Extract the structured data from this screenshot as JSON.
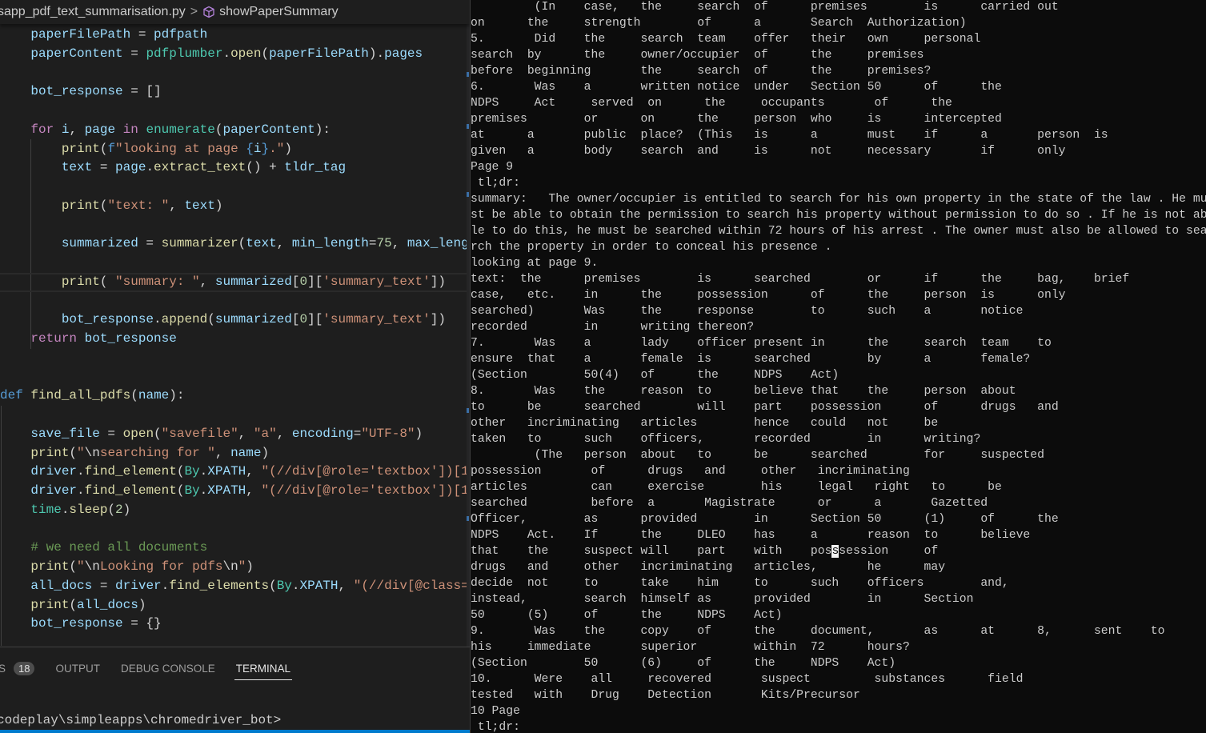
{
  "breadcrumb": {
    "file": "sapp_pdf_text_summarisation.py",
    "separator": ">",
    "symbol": "showPaperSummary",
    "symbol_icon": "cube-icon",
    "symbol_icon_color": "#b180d7"
  },
  "code_lines": [
    [
      [
        "t-p",
        "    "
      ],
      [
        "t-v",
        "paperFilePath"
      ],
      [
        "t-p",
        " = "
      ],
      [
        "t-v",
        "pdfpath"
      ]
    ],
    [
      [
        "t-p",
        "    "
      ],
      [
        "t-v",
        "paperContent"
      ],
      [
        "t-p",
        " = "
      ],
      [
        "t-c",
        "pdfplumber"
      ],
      [
        "t-p",
        "."
      ],
      [
        "t-f",
        "open"
      ],
      [
        "t-p",
        "("
      ],
      [
        "t-v",
        "paperFilePath"
      ],
      [
        "t-p",
        ")."
      ],
      [
        "t-v",
        "pages"
      ]
    ],
    [],
    [
      [
        "t-p",
        "    "
      ],
      [
        "t-v",
        "bot_response"
      ],
      [
        "t-p",
        " = []"
      ]
    ],
    [],
    [
      [
        "t-p",
        "    "
      ],
      [
        "t-k",
        "for"
      ],
      [
        "t-p",
        " "
      ],
      [
        "t-v",
        "i"
      ],
      [
        "t-p",
        ", "
      ],
      [
        "t-v",
        "page"
      ],
      [
        "t-p",
        " "
      ],
      [
        "t-k",
        "in"
      ],
      [
        "t-p",
        " "
      ],
      [
        "t-c",
        "enumerate"
      ],
      [
        "t-p",
        "("
      ],
      [
        "t-v",
        "paperContent"
      ],
      [
        "t-p",
        "):"
      ]
    ],
    [
      [
        "t-p",
        "        "
      ],
      [
        "t-f",
        "print"
      ],
      [
        "t-p",
        "("
      ],
      [
        "t-kw",
        "f"
      ],
      [
        "t-s",
        "\"looking at page "
      ],
      [
        "t-kw",
        "{"
      ],
      [
        "t-v",
        "i"
      ],
      [
        "t-kw",
        "}"
      ],
      [
        "t-s",
        ".\""
      ],
      [
        "t-p",
        ")"
      ]
    ],
    [
      [
        "t-p",
        "        "
      ],
      [
        "t-v",
        "text"
      ],
      [
        "t-p",
        " = "
      ],
      [
        "t-v",
        "page"
      ],
      [
        "t-p",
        "."
      ],
      [
        "t-f",
        "extract_text"
      ],
      [
        "t-p",
        "() + "
      ],
      [
        "t-v",
        "tldr_tag"
      ]
    ],
    [],
    [
      [
        "t-p",
        "        "
      ],
      [
        "t-f",
        "print"
      ],
      [
        "t-p",
        "("
      ],
      [
        "t-s",
        "\"text: \""
      ],
      [
        "t-p",
        ", "
      ],
      [
        "t-v",
        "text"
      ],
      [
        "t-p",
        ")"
      ]
    ],
    [],
    [
      [
        "t-p",
        "        "
      ],
      [
        "t-v",
        "summarized"
      ],
      [
        "t-p",
        " = "
      ],
      [
        "t-f",
        "summarizer"
      ],
      [
        "t-p",
        "("
      ],
      [
        "t-v",
        "text"
      ],
      [
        "t-p",
        ", "
      ],
      [
        "t-v",
        "min_length"
      ],
      [
        "t-p",
        "="
      ],
      [
        "t-n",
        "75"
      ],
      [
        "t-p",
        ", "
      ],
      [
        "t-v",
        "max_leng"
      ]
    ],
    [],
    [
      [
        "t-p",
        "        "
      ],
      [
        "t-f",
        "print"
      ],
      [
        "t-p",
        "( "
      ],
      [
        "t-s",
        "\"summary: \""
      ],
      [
        "t-p",
        ", "
      ],
      [
        "t-v",
        "summarized"
      ],
      [
        "t-p",
        "["
      ],
      [
        "t-n",
        "0"
      ],
      [
        "t-p",
        "]["
      ],
      [
        "t-s",
        "'summary_text'"
      ],
      [
        "t-p",
        "])"
      ]
    ],
    [],
    [
      [
        "t-p",
        "        "
      ],
      [
        "t-v",
        "bot_response"
      ],
      [
        "t-p",
        "."
      ],
      [
        "t-f",
        "append"
      ],
      [
        "t-p",
        "("
      ],
      [
        "t-v",
        "summarized"
      ],
      [
        "t-p",
        "["
      ],
      [
        "t-n",
        "0"
      ],
      [
        "t-p",
        "]["
      ],
      [
        "t-s",
        "'summary_text'"
      ],
      [
        "t-p",
        "])"
      ]
    ],
    [
      [
        "t-p",
        "    "
      ],
      [
        "t-k",
        "return"
      ],
      [
        "t-p",
        " "
      ],
      [
        "t-v",
        "bot_response"
      ]
    ],
    [],
    [],
    [
      [
        "t-kw",
        "def"
      ],
      [
        "t-p",
        " "
      ],
      [
        "t-f",
        "find_all_pdfs"
      ],
      [
        "t-p",
        "("
      ],
      [
        "t-v",
        "name"
      ],
      [
        "t-p",
        "):"
      ]
    ],
    [],
    [
      [
        "t-p",
        "    "
      ],
      [
        "t-v",
        "save_file"
      ],
      [
        "t-p",
        " = "
      ],
      [
        "t-f",
        "open"
      ],
      [
        "t-p",
        "("
      ],
      [
        "t-s",
        "\"savefile\""
      ],
      [
        "t-p",
        ", "
      ],
      [
        "t-s",
        "\"a\""
      ],
      [
        "t-p",
        ", "
      ],
      [
        "t-v",
        "encoding"
      ],
      [
        "t-p",
        "="
      ],
      [
        "t-s",
        "\"UTF-8\""
      ],
      [
        "t-p",
        ")"
      ]
    ],
    [
      [
        "t-p",
        "    "
      ],
      [
        "t-f",
        "print"
      ],
      [
        "t-p",
        "("
      ],
      [
        "t-s",
        "\""
      ],
      [
        "t-p",
        "\\n"
      ],
      [
        "t-s",
        "searching for \""
      ],
      [
        "t-p",
        ", "
      ],
      [
        "t-v",
        "name"
      ],
      [
        "t-p",
        ")"
      ]
    ],
    [
      [
        "t-p",
        "    "
      ],
      [
        "t-v",
        "driver"
      ],
      [
        "t-p",
        "."
      ],
      [
        "t-f",
        "find_element"
      ],
      [
        "t-p",
        "("
      ],
      [
        "t-c",
        "By"
      ],
      [
        "t-p",
        "."
      ],
      [
        "t-v",
        "XPATH"
      ],
      [
        "t-p",
        ", "
      ],
      [
        "t-s",
        "\"(//div[@role='textbox'])[1"
      ]
    ],
    [
      [
        "t-p",
        "    "
      ],
      [
        "t-v",
        "driver"
      ],
      [
        "t-p",
        "."
      ],
      [
        "t-f",
        "find_element"
      ],
      [
        "t-p",
        "("
      ],
      [
        "t-c",
        "By"
      ],
      [
        "t-p",
        "."
      ],
      [
        "t-v",
        "XPATH"
      ],
      [
        "t-p",
        ", "
      ],
      [
        "t-s",
        "\"(//div[@role='textbox'])[1"
      ]
    ],
    [
      [
        "t-p",
        "    "
      ],
      [
        "t-c",
        "time"
      ],
      [
        "t-p",
        "."
      ],
      [
        "t-f",
        "sleep"
      ],
      [
        "t-p",
        "("
      ],
      [
        "t-n",
        "2"
      ],
      [
        "t-p",
        ")"
      ]
    ],
    [],
    [
      [
        "t-p",
        "    "
      ],
      [
        "t-cm",
        "# we need all documents"
      ]
    ],
    [
      [
        "t-p",
        "    "
      ],
      [
        "t-f",
        "print"
      ],
      [
        "t-p",
        "("
      ],
      [
        "t-s",
        "\""
      ],
      [
        "t-p",
        "\\n"
      ],
      [
        "t-s",
        "Looking for pdfs"
      ],
      [
        "t-p",
        "\\n"
      ],
      [
        "t-s",
        "\""
      ],
      [
        "t-p",
        ")"
      ]
    ],
    [
      [
        "t-p",
        "    "
      ],
      [
        "t-v",
        "all_docs"
      ],
      [
        "t-p",
        " = "
      ],
      [
        "t-v",
        "driver"
      ],
      [
        "t-p",
        "."
      ],
      [
        "t-f",
        "find_elements"
      ],
      [
        "t-p",
        "("
      ],
      [
        "t-c",
        "By"
      ],
      [
        "t-p",
        "."
      ],
      [
        "t-v",
        "XPATH"
      ],
      [
        "t-p",
        ", "
      ],
      [
        "t-s",
        "\"(//div[@class="
      ]
    ],
    [
      [
        "t-p",
        "    "
      ],
      [
        "t-f",
        "print"
      ],
      [
        "t-p",
        "("
      ],
      [
        "t-v",
        "all_docs"
      ],
      [
        "t-p",
        ")"
      ]
    ],
    [
      [
        "t-p",
        "    "
      ],
      [
        "t-v",
        "bot_response"
      ],
      [
        "t-p",
        " = {}"
      ]
    ]
  ],
  "panel": {
    "tabs": [
      {
        "label": "S",
        "badge": "18"
      },
      {
        "label": "OUTPUT"
      },
      {
        "label": "DEBUG CONSOLE"
      },
      {
        "label": "TERMINAL",
        "active": true
      }
    ],
    "prompt": "codeplay\\simpleapps\\chromedriver_bot>"
  },
  "colors": {
    "editor_bg": "#1e1e1e",
    "terminal_bg": "#0c0c0c",
    "status_bar": "#007acc"
  },
  "terminal_lines": [
    "\t (In\tcase,\tthe\tsearch\tof\tpremises\tis\tcarried out",
    "on\tthe\tstrength\tof\ta\tSearch\tAuthorization)",
    "5.\t Did\tthe\tsearch\tteam\toffer\ttheir\town\tpersonal",
    "search\tby\tthe\towner/occupier\tof\tthe\tpremises",
    "before\tbeginning\tthe\tsearch\tof\tthe\tpremises?",
    "6.\t Was\ta\twritten notice\tunder\tSection 50\tof\tthe",
    "NDPS\t Act\t served\t on\t the\t occupants\t of\t the",
    "premises\tor\ton\tthe\tperson\twho\tis\tintercepted",
    "at\ta\tpublic\tplace?\t(This\tis\ta\tmust\tif\ta\tperson\tis",
    "given\ta\tbody\tsearch\tand\tis\tnot\tnecessary\tif\tonly",
    "Page 9",
    " tl;dr:",
    "summary:   The owner/occupier is entitled to search for his own property in the state of the law . He mu",
    "st be able to obtain the permission to search his property without permission to do so . If he is not ab",
    "le to do this, he must be searched within 72 hours of his arrest . The owner must also be allowed to sea",
    "rch the property in order to conceal his presence .",
    "looking at page 9.",
    "text:  the\tpremises\tis\tsearched\tor\tif\tthe\tbag,\tbrief",
    "case,\tetc.\tin\tthe\tpossession\tof\tthe\tperson\tis\tonly",
    "searched)\tWas\tthe\tresponse\tto\tsuch\ta\tnotice",
    "recorded\tin\twriting thereon?",
    "7.\t Was\ta\tlady\tofficer present in\tthe\tsearch\tteam\tto",
    "ensure\tthat\ta\tfemale\tis\tsearched\tby\ta\tfemale?",
    "(Section\t50(4)\tof\tthe\tNDPS\tAct)",
    "8.\t Was\tthe\treason\tto\tbelieve that\tthe\tperson\tabout",
    "to\tbe\tsearched\twill\tpart\tpossession\tof\tdrugs\tand",
    "other\tincriminating\tarticles\thence\tcould\tnot\tbe",
    "taken\tto\tsuch\tofficers,\trecorded\tin\twriting?",
    "\t (The\tperson\tabout\tto\tbe\tsearched\tfor\tsuspected",
    "possession\t of\t drugs\t and\t other\t incriminating",
    "articles\t can\t exercise\t his\t legal\t right\t to\t be",
    "searched\t before\t a\t Magistrate\t or\t a\t Gazetted",
    "Officer,\tas\tprovided\tin\tSection 50\t(1)\tof\tthe",
    "NDPS\tAct.\tIf\tthe\tDLEO\thas\ta\treason\tto\tbelieve",
    {
      "before": "that\tthe\tsuspect will\tpart\twith\tpos",
      "cursor": "s",
      "after": "session\tof"
    },
    "drugs\tand\tother\tincriminating\tarticles,\the\tmay",
    "decide\tnot\tto\ttake\thim\tto\tsuch\tofficers\tand,",
    "instead,\tsearch\thimself as\tprovided\tin\tSection",
    "50\t(5)\tof\tthe\tNDPS\tAct)",
    "9.\t Was\tthe\tcopy\tof\tthe\tdocument,\tas\tat\t8,\tsent\tto",
    "his\timmediate\tsuperior\twithin\t72\thours?",
    "(Section\t50\t(6)\tof\tthe\tNDPS\tAct)",
    "10.\t Were\t all\t recovered\t suspect\t substances\t field",
    "tested\t with\t Drug\t Detection\t Kits/Precursor",
    "10 Page",
    " tl;dr:"
  ]
}
